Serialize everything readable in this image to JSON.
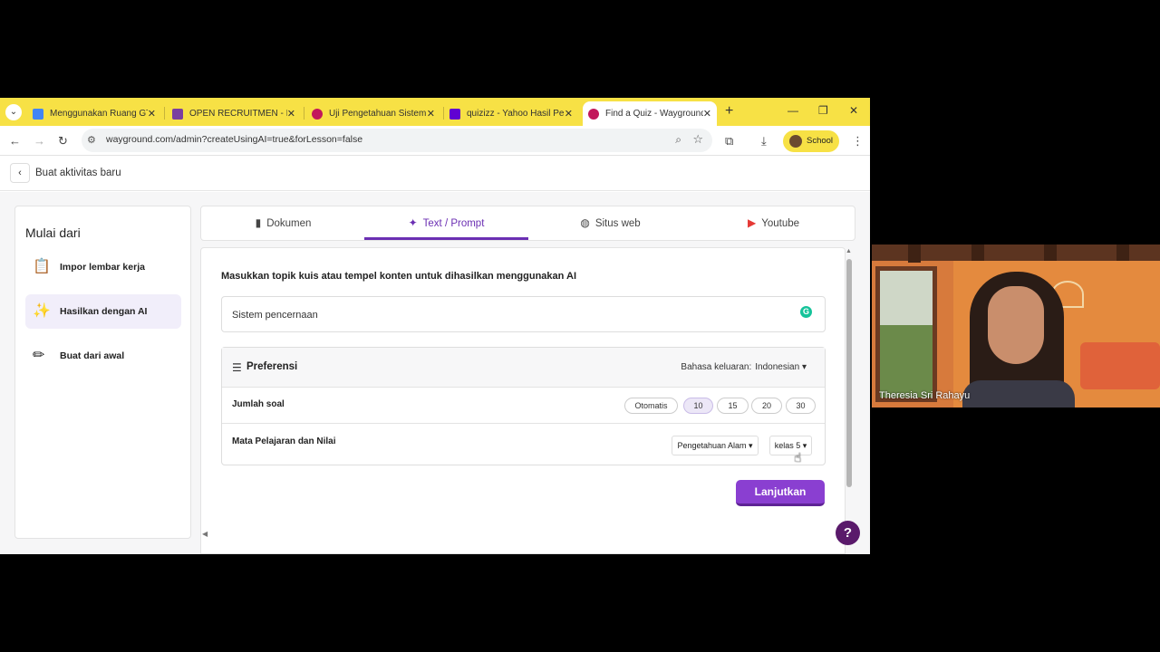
{
  "browser": {
    "tabs": [
      {
        "title": "Menggunakan Ruang GT",
        "favicon_color": "#4285f4"
      },
      {
        "title": "OPEN RECRUITMEN - IN",
        "favicon_color": "#7b3fa0"
      },
      {
        "title": "Uji Pengetahuan Sistem",
        "favicon_color": "#c2185b"
      },
      {
        "title": "quizizz - Yahoo Hasil Pen",
        "favicon_color": "#6001d2"
      },
      {
        "title": "Find a Quiz - Wayground",
        "favicon_color": "#c2185b"
      }
    ],
    "url": "wayground.com/admin?createUsingAI=true&forLesson=false",
    "profile_label": "School",
    "accent": "#f7e145"
  },
  "page": {
    "title": "Buat aktivitas baru"
  },
  "sidebar": {
    "heading": "Mulai dari",
    "items": [
      {
        "label": "Impor lembar kerja",
        "icon": "clipboard-icon"
      },
      {
        "label": "Hasilkan dengan AI",
        "icon": "magic-wand-icon"
      },
      {
        "label": "Buat dari awal",
        "icon": "pencil-icon"
      }
    ]
  },
  "source_tabs": [
    {
      "label": "Dokumen",
      "icon": "document-icon"
    },
    {
      "label": "Text / Prompt",
      "icon": "sparkle-icon"
    },
    {
      "label": "Situs web",
      "icon": "globe-icon"
    },
    {
      "label": "Youtube",
      "icon": "youtube-icon"
    }
  ],
  "form": {
    "instruction": "Masukkan topik kuis atau tempel konten untuk dihasilkan menggunakan AI",
    "prompt_value": "Sistem pencernaan",
    "preferences_title": "Preferensi",
    "output_language_label": "Bahasa keluaran:",
    "output_language_value": "Indonesian",
    "question_count_label": "Jumlah soal",
    "question_count_options": [
      "Otomatis",
      "10",
      "15",
      "20",
      "30"
    ],
    "question_count_selected": "10",
    "subject_grade_label": "Mata Pelajaran dan Nilai",
    "subject_value": "Pengetahuan Alam",
    "grade_value": "kelas 5",
    "continue_label": "Lanjutkan",
    "brand_color": "#8a3fd1"
  },
  "help_label": "?",
  "webcam": {
    "participant_name": "Theresia Sri Rahayu"
  }
}
